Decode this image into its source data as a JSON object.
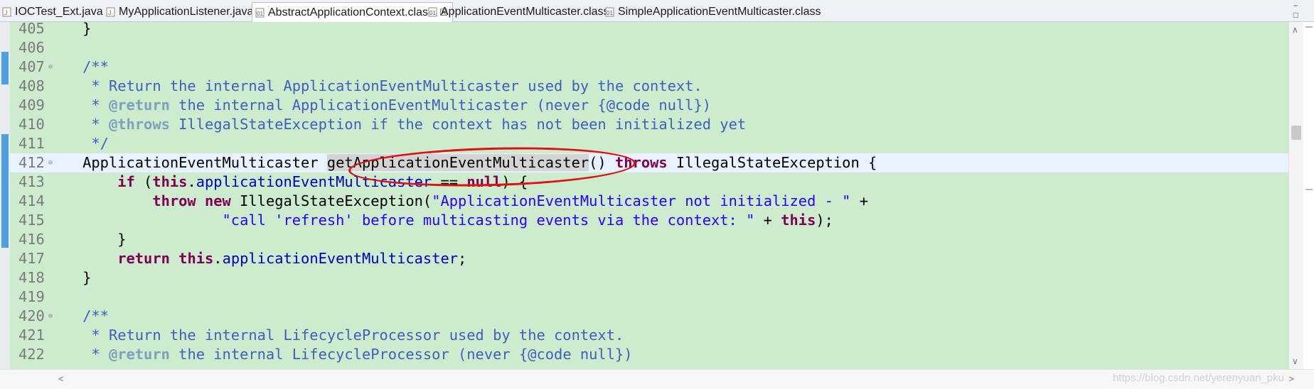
{
  "tabs": [
    {
      "label": "IOCTest_Ext.java",
      "icon": "java-file-icon",
      "active": false
    },
    {
      "label": "MyApplicationListener.java",
      "icon": "java-file-icon",
      "active": false
    },
    {
      "label": "AbstractApplicationContext.class",
      "icon": "class-file-icon",
      "active": true,
      "close": "☒"
    },
    {
      "label": "ApplicationEventMulticaster.class",
      "icon": "class-file-icon",
      "active": false
    },
    {
      "label": "SimpleApplicationEventMulticaster.class",
      "icon": "class-file-icon",
      "active": false
    }
  ],
  "window_buttons": {
    "minimize": "−",
    "maximize": "□"
  },
  "colors": {
    "editor_bg": "#cdeccd",
    "current_line": "#e8f2fe",
    "keyword": "#7f0055",
    "javadoc": "#3f5fbf",
    "string": "#2a00ff",
    "field": "#0000c0",
    "annotation_mark": "#e01010"
  },
  "editor": {
    "lines": [
      {
        "num": "405",
        "fold": "",
        "code": [
          {
            "t": "}",
            "c": ""
          }
        ],
        "indent": "    "
      },
      {
        "num": "406",
        "fold": "",
        "code": [],
        "indent": ""
      },
      {
        "num": "407",
        "fold": "⊖",
        "code": [
          {
            "t": "/**",
            "c": "doc"
          }
        ],
        "indent": "    "
      },
      {
        "num": "408",
        "fold": "",
        "code": [
          {
            "t": " * Return the internal ApplicationEventMulticaster used by the context.",
            "c": "doc"
          }
        ],
        "indent": "    "
      },
      {
        "num": "409",
        "fold": "",
        "code": [
          {
            "t": " * ",
            "c": "doc"
          },
          {
            "t": "@return",
            "c": "tag"
          },
          {
            "t": " the internal ApplicationEventMulticaster (never {@code null})",
            "c": "doc"
          }
        ],
        "indent": "    "
      },
      {
        "num": "410",
        "fold": "",
        "code": [
          {
            "t": " * ",
            "c": "doc"
          },
          {
            "t": "@throws",
            "c": "tag"
          },
          {
            "t": " IllegalStateException if the context has not been initialized yet",
            "c": "doc"
          }
        ],
        "indent": "    "
      },
      {
        "num": "411",
        "fold": "",
        "code": [
          {
            "t": " */",
            "c": "doc"
          }
        ],
        "indent": "    "
      },
      {
        "num": "412",
        "fold": "⊖",
        "current": true,
        "code": [
          {
            "t": "ApplicationEventMulticaster ",
            "c": ""
          },
          {
            "t": "getApplicationEventMulticaster",
            "c": "hl"
          },
          {
            "t": "() ",
            "c": ""
          },
          {
            "t": "throws",
            "c": "kw"
          },
          {
            "t": " IllegalStateException {",
            "c": ""
          }
        ],
        "indent": "    "
      },
      {
        "num": "413",
        "fold": "",
        "code": [
          {
            "t": "if",
            "c": "kw"
          },
          {
            "t": " (",
            "c": ""
          },
          {
            "t": "this",
            "c": "kw"
          },
          {
            "t": ".",
            "c": ""
          },
          {
            "t": "applicationEventMulticaster",
            "c": "fld"
          },
          {
            "t": " == ",
            "c": ""
          },
          {
            "t": "null",
            "c": "kw"
          },
          {
            "t": ") {",
            "c": ""
          }
        ],
        "indent": "        "
      },
      {
        "num": "414",
        "fold": "",
        "code": [
          {
            "t": "throw",
            "c": "kw"
          },
          {
            "t": " ",
            "c": ""
          },
          {
            "t": "new",
            "c": "kw"
          },
          {
            "t": " IllegalStateException(",
            "c": ""
          },
          {
            "t": "\"ApplicationEventMulticaster not initialized - \"",
            "c": "str"
          },
          {
            "t": " +",
            "c": ""
          }
        ],
        "indent": "            "
      },
      {
        "num": "415",
        "fold": "",
        "code": [
          {
            "t": "\"call 'refresh' before multicasting events via the context: \"",
            "c": "str"
          },
          {
            "t": " + ",
            "c": ""
          },
          {
            "t": "this",
            "c": "kw"
          },
          {
            "t": ");",
            "c": ""
          }
        ],
        "indent": "                    "
      },
      {
        "num": "416",
        "fold": "",
        "code": [
          {
            "t": "}",
            "c": ""
          }
        ],
        "indent": "        "
      },
      {
        "num": "417",
        "fold": "",
        "code": [
          {
            "t": "return",
            "c": "kw"
          },
          {
            "t": " ",
            "c": ""
          },
          {
            "t": "this",
            "c": "kw"
          },
          {
            "t": ".",
            "c": ""
          },
          {
            "t": "applicationEventMulticaster",
            "c": "fld"
          },
          {
            "t": ";",
            "c": ""
          }
        ],
        "indent": "        "
      },
      {
        "num": "418",
        "fold": "",
        "code": [
          {
            "t": "}",
            "c": ""
          }
        ],
        "indent": "    "
      },
      {
        "num": "419",
        "fold": "",
        "code": [],
        "indent": ""
      },
      {
        "num": "420",
        "fold": "⊖",
        "code": [
          {
            "t": "/**",
            "c": "doc"
          }
        ],
        "indent": "    "
      },
      {
        "num": "421",
        "fold": "",
        "code": [
          {
            "t": " * Return the internal LifecycleProcessor used by the context.",
            "c": "doc"
          }
        ],
        "indent": "    "
      },
      {
        "num": "422",
        "fold": "",
        "code": [
          {
            "t": " * ",
            "c": "doc"
          },
          {
            "t": "@return",
            "c": "tag"
          },
          {
            "t": " the internal LifecycleProcessor (never {@code null})",
            "c": "doc"
          }
        ],
        "indent": "    "
      }
    ]
  },
  "scrollbar": {
    "up": "∧",
    "down": "∨",
    "left": "<",
    "right": ">"
  },
  "watermark": "https://blog.csdn.net/yerenyuan_pku"
}
